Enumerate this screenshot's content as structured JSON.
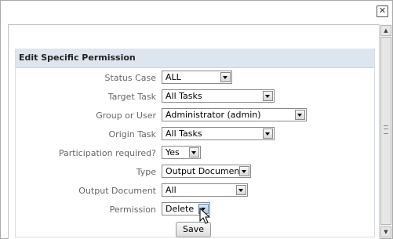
{
  "dialog": {
    "close_label": "✕"
  },
  "panel": {
    "title": "Edit Specific Permission"
  },
  "fields": [
    {
      "label": "Status Case",
      "value": "ALL"
    },
    {
      "label": "Target Task",
      "value": "All Tasks"
    },
    {
      "label": "Group or User",
      "value": "Administrator (admin)"
    },
    {
      "label": "Origin Task",
      "value": "All Tasks"
    },
    {
      "label": "Participation required?",
      "value": "Yes"
    },
    {
      "label": "Type",
      "value": "Output Document"
    },
    {
      "label": "Output Document",
      "value": "All"
    },
    {
      "label": "Permission",
      "value": "Delete"
    }
  ],
  "actions": {
    "save_label": "Save"
  },
  "colors": {
    "panel_header": "#dde6ef",
    "label_text": "#666666"
  }
}
